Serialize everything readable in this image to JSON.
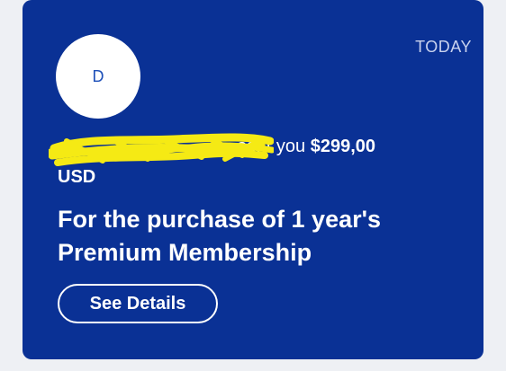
{
  "notification": {
    "date": "TODAY",
    "avatar_initial": "D",
    "sender_redacted": "",
    "sent_text": "sent you",
    "amount": "$299,00",
    "currency": "USD",
    "message": "For the purchase of 1 year's Premium Membership",
    "details_button": "See Details"
  },
  "colors": {
    "card_background": "#0a3195",
    "page_background": "#eef0f4",
    "highlighter": "#f5ea14",
    "avatar_text": "#1d4fb8"
  }
}
